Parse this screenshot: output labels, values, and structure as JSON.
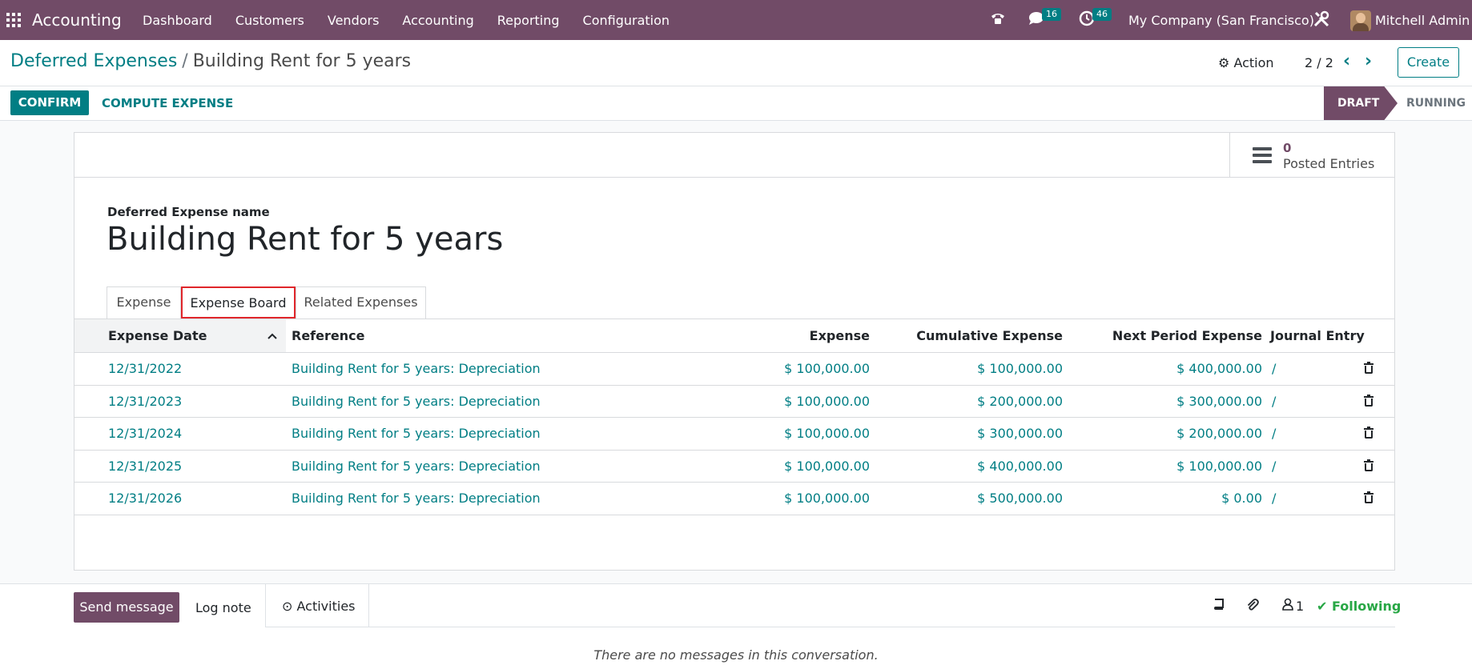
{
  "navbar": {
    "app_name": "Accounting",
    "menu": [
      "Dashboard",
      "Customers",
      "Vendors",
      "Accounting",
      "Reporting",
      "Configuration"
    ],
    "messages_count": "16",
    "activities_count": "46",
    "company": "My Company (San Francisco)",
    "user": "Mitchell Admin",
    "brand_color": "#714b67"
  },
  "breadcrumb": {
    "parent": "Deferred Expenses",
    "separator": "/",
    "current": "Building Rent for 5 years"
  },
  "control": {
    "action_label": "Action",
    "pager": "2 / 2",
    "create_label": "Create"
  },
  "statusbar": {
    "confirm_label": "CONFIRM",
    "compute_label": "COMPUTE EXPENSE",
    "stages": [
      "DRAFT",
      "RUNNING"
    ],
    "active_stage": "DRAFT"
  },
  "smart_button": {
    "value": "0",
    "label": "Posted Entries"
  },
  "form": {
    "name_label": "Deferred Expense name",
    "name_value": "Building Rent for 5 years"
  },
  "tabs": [
    "Expense",
    "Expense Board",
    "Related Expenses"
  ],
  "active_tab": "Expense Board",
  "table": {
    "columns": [
      "Expense Date",
      "Reference",
      "Expense",
      "Cumulative Expense",
      "Next Period Expense",
      "Journal Entry"
    ],
    "rows": [
      {
        "date": "12/31/2022",
        "reference": "Building Rent for 5 years: Depreciation",
        "expense": "$ 100,000.00",
        "cumulative": "$ 100,000.00",
        "next": "$ 400,000.00",
        "journal": "/"
      },
      {
        "date": "12/31/2023",
        "reference": "Building Rent for 5 years: Depreciation",
        "expense": "$ 100,000.00",
        "cumulative": "$ 200,000.00",
        "next": "$ 300,000.00",
        "journal": "/"
      },
      {
        "date": "12/31/2024",
        "reference": "Building Rent for 5 years: Depreciation",
        "expense": "$ 100,000.00",
        "cumulative": "$ 300,000.00",
        "next": "$ 200,000.00",
        "journal": "/"
      },
      {
        "date": "12/31/2025",
        "reference": "Building Rent for 5 years: Depreciation",
        "expense": "$ 100,000.00",
        "cumulative": "$ 400,000.00",
        "next": "$ 100,000.00",
        "journal": "/"
      },
      {
        "date": "12/31/2026",
        "reference": "Building Rent for 5 years: Depreciation",
        "expense": "$ 100,000.00",
        "cumulative": "$ 500,000.00",
        "next": "$ 0.00",
        "journal": "/"
      }
    ]
  },
  "chatter": {
    "send_label": "Send message",
    "log_label": "Log note",
    "activities_label": "Activities",
    "followers_count": "1",
    "following_label": "Following",
    "empty_text": "There are no messages in this conversation."
  },
  "icons": {
    "apps": "apps-grid-icon",
    "phone": "phone-icon",
    "chat": "chat-icon",
    "clock": "clock-icon",
    "tools": "tools-icon",
    "gear": "gear-icon",
    "list": "list-icon",
    "trash": "trash-icon",
    "book": "book-icon",
    "paperclip": "paperclip-icon",
    "user": "user-icon",
    "check": "check-icon"
  },
  "colors": {
    "accent": "#017e84",
    "brand": "#714b67",
    "following": "#28a745",
    "tab_highlight": "#e0262b"
  }
}
